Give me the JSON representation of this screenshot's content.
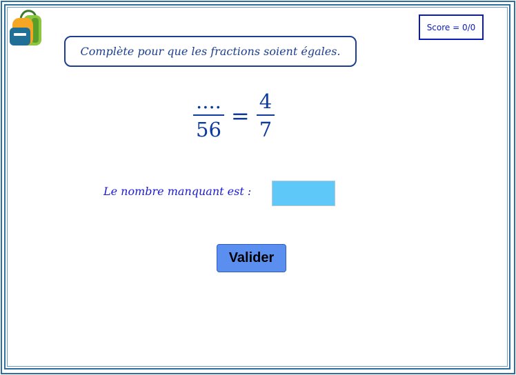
{
  "header": {
    "score": "Score = 0/0",
    "logo_icon": "backpack-icon"
  },
  "instruction": "Complète pour que les fractions soient égales.",
  "equation": {
    "left_numerator": "....",
    "left_denominator": "56",
    "equals": "=",
    "right_numerator": "4",
    "right_denominator": "7"
  },
  "answer": {
    "label": "Le nombre manquant est :",
    "value": ""
  },
  "validate_label": "Valider",
  "colors": {
    "frame": "#2f6fa0",
    "text_blue": "#1a1ad6",
    "input_bg": "#5ec8f8",
    "button_bg": "#5b8fef"
  }
}
